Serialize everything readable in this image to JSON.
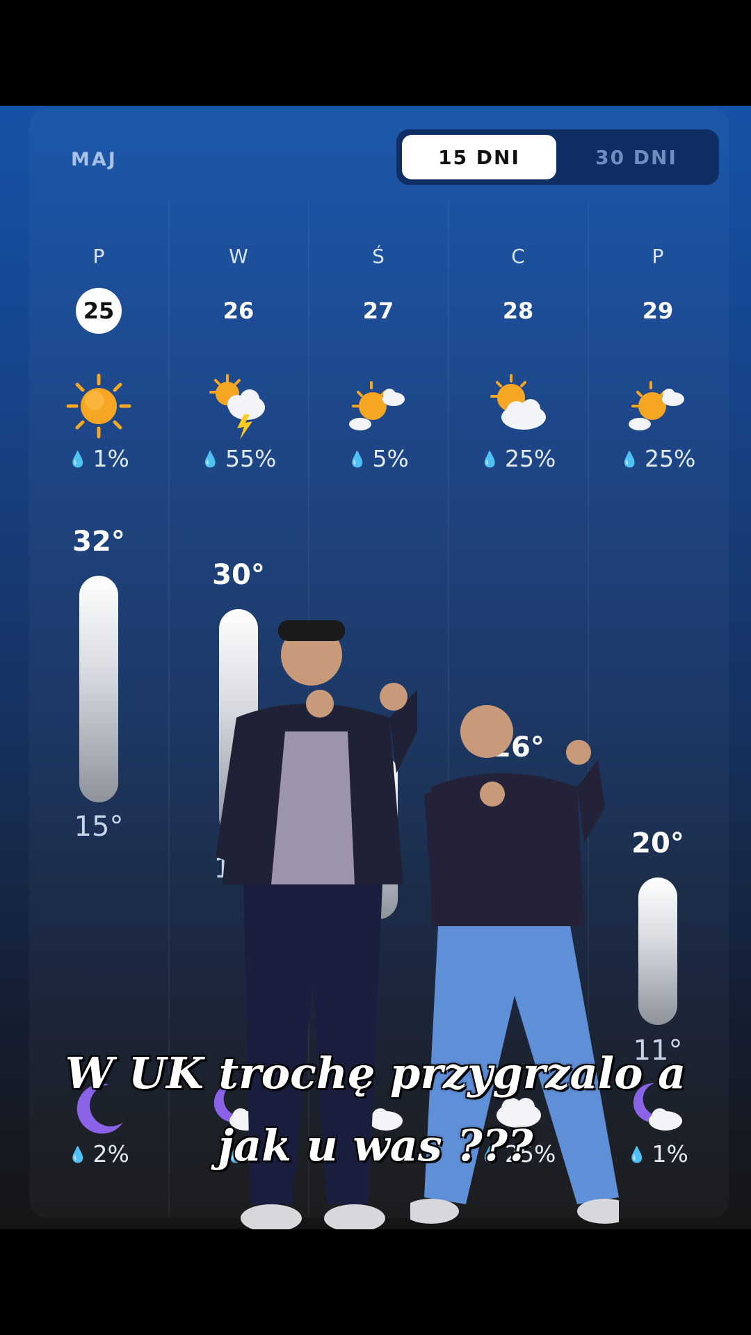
{
  "header": {
    "month": "MAJ",
    "range_tabs": [
      {
        "label": "15 DNI",
        "selected": true
      },
      {
        "label": "30 DNI",
        "selected": false
      }
    ]
  },
  "days": [
    {
      "dow": "P",
      "date": "25",
      "today": true,
      "day_icon": "sun-icon",
      "precip_day": "1%",
      "high": "32°",
      "low": "15°",
      "night_icon": "moon-icon",
      "precip_night": "2%"
    },
    {
      "dow": "W",
      "date": "26",
      "today": false,
      "day_icon": "sun-cloud-lightning-icon",
      "precip_day": "55%",
      "high": "30°",
      "low": "12°",
      "night_icon": "moon-cloud-icon",
      "precip_night": ""
    },
    {
      "dow": "Ś",
      "date": "27",
      "today": false,
      "day_icon": "sun-cloud-icon",
      "precip_day": "5%",
      "high": "",
      "low": "",
      "night_icon": "moon-cloud-icon",
      "precip_night": ""
    },
    {
      "dow": "C",
      "date": "28",
      "today": false,
      "day_icon": "sun-behind-cloud-icon",
      "precip_day": "25%",
      "high": "26°",
      "low": "",
      "night_icon": "cloud-icon",
      "precip_night": "25%"
    },
    {
      "dow": "P",
      "date": "29",
      "today": false,
      "day_icon": "sun-cloud-icon",
      "precip_day": "25%",
      "high": "20°",
      "low": "11°",
      "night_icon": "moon-cloud-icon",
      "precip_night": "1%"
    }
  ],
  "temperature_ranges": [
    {
      "high": 32,
      "low": 15
    },
    {
      "high": 30,
      "low": 12
    },
    {
      "high": 22,
      "low": 9
    },
    {
      "high": 26,
      "low": 12
    },
    {
      "high": 20,
      "low": 11
    }
  ],
  "caption": {
    "line1": "W UK trochę przygrzalo a",
    "line2": "jak u was ???"
  },
  "colors": {
    "accent": "#ffffff",
    "sun": "#f5a623",
    "moon": "#8a63e6",
    "background_top": "#1553a8",
    "background_bottom": "#151515"
  }
}
